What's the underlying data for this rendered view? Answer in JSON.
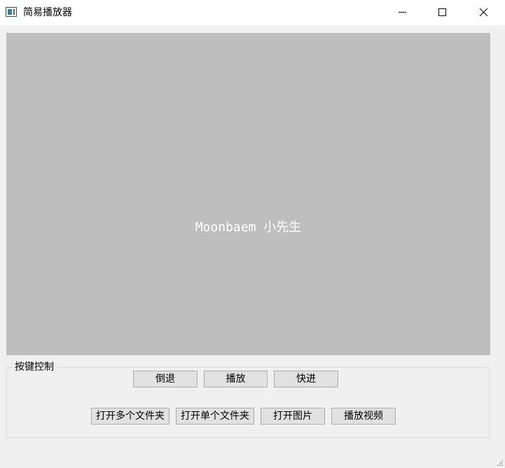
{
  "window": {
    "title": "简易播放器",
    "icon": "video-app-icon",
    "controls": {
      "minimize_icon": "minimize-icon",
      "maximize_icon": "maximize-icon",
      "close_icon": "close-icon"
    }
  },
  "video": {
    "overlay_text": "Moonbaem 小先生",
    "background_color": "#bebebe"
  },
  "controls_group": {
    "title": "按键控制",
    "row1": {
      "rewind_label": "倒退",
      "play_label": "播放",
      "forward_label": "快进"
    },
    "row2": {
      "open_multiple_folders_label": "打开多个文件夹",
      "open_single_folder_label": "打开单个文件夹",
      "open_image_label": "打开图片",
      "play_video_label": "播放视频"
    }
  },
  "colors": {
    "window_bg": "#f0f0f0",
    "titlebar_bg": "#ffffff",
    "button_bg": "#e1e1e1",
    "button_border": "#adadad"
  }
}
